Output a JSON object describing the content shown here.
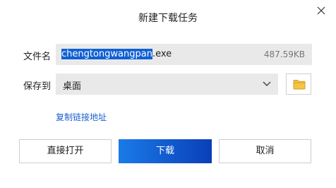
{
  "dialog": {
    "title": "新建下载任务"
  },
  "file": {
    "label": "文件名",
    "name_selected": "chengtongwangpan",
    "name_ext": ".exe",
    "size": "487.59KB"
  },
  "save": {
    "label": "保存到",
    "location": "桌面"
  },
  "links": {
    "copy_link": "复制链接地址"
  },
  "buttons": {
    "open_direct": "直接打开",
    "download": "下载",
    "cancel": "取消"
  },
  "icons": {
    "close": "close-icon",
    "chevron": "chevron-down-icon",
    "folder": "folder-icon"
  },
  "colors": {
    "accent": "#1a5fd0",
    "selection": "#1060d4",
    "folder": "#f5c542"
  }
}
